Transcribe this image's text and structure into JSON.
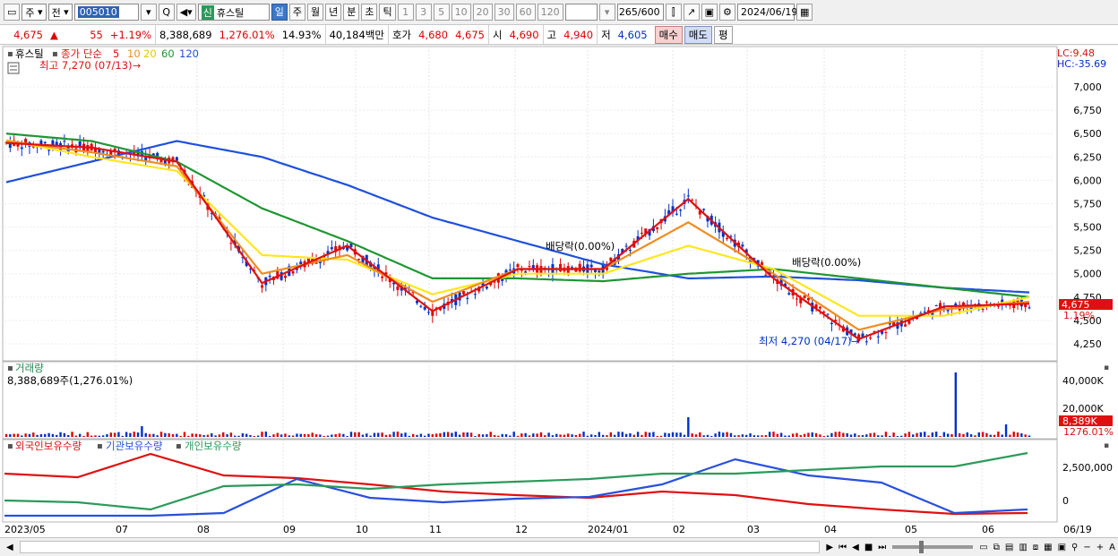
{
  "toolbar": {
    "period_type": "주",
    "prev": "전",
    "code": "005010",
    "stock_badge": "신",
    "stock_name": "휴스틸",
    "periods": [
      "일",
      "주",
      "월",
      "년",
      "분",
      "초",
      "틱"
    ],
    "active_period": "일",
    "intervals": [
      "1",
      "3",
      "5",
      "10",
      "20",
      "30",
      "60",
      "120"
    ],
    "count": "265",
    "count_max": "/600",
    "date": "2024/06/19"
  },
  "quote": {
    "price": "4,675",
    "change_arrow": "▲",
    "change": "55",
    "change_pct": "+1.19%",
    "volume": "8,388,689",
    "volume_pct": "1,276.01%",
    "turnover": "14.93%",
    "amount": "40,184백만",
    "ask_label": "호가",
    "ask1": "4,680",
    "ask2": "4,675",
    "open_label": "시",
    "open": "4,690",
    "high_label": "고",
    "high": "4,940",
    "low_label": "저",
    "low": "4,605",
    "buy_label": "매수",
    "sell_label": "매도",
    "eval_label": "평"
  },
  "price_panel": {
    "stock_name": "휴스틸",
    "ma_title": "종가 단순",
    "ma_periods": [
      "5",
      "10",
      "20",
      "60",
      "120"
    ],
    "max_label": "최고 7,270 (07/13)",
    "min_label": "최저 4,270 (04/17)",
    "dividend_label_1": "배당락(0.00%)",
    "dividend_label_2": "배당락(0.00%)",
    "lc": "LC:9.48",
    "hc": "HC:-35.69",
    "current_tag": "4,675",
    "current_pct_tag": "1.19%",
    "y_ticks": [
      "7,000",
      "6,750",
      "6,500",
      "6,250",
      "6,000",
      "5,750",
      "5,500",
      "5,250",
      "5,000",
      "4,750",
      "4,500",
      "4,250"
    ]
  },
  "volume_panel": {
    "title": "거래량",
    "value_label": "8,388,689주(1,276.01%)",
    "y_ticks": [
      "40,000K",
      "20,000K"
    ],
    "current_tag": "8,389K",
    "current_pct_tag": "1276.01%"
  },
  "holding_panel": {
    "series": [
      "외국인보유수량",
      "기관보유수량",
      "개인보유수량"
    ],
    "y_ticks": [
      "2,500,000",
      "0"
    ]
  },
  "x_axis": [
    "2023/05",
    "07",
    "08",
    "09",
    "10",
    "11",
    "12",
    "2024/01",
    "02",
    "03",
    "04",
    "05",
    "06",
    "06/19"
  ],
  "colors": {
    "ma5": "#e01010",
    "ma10": "#f08c1e",
    "ma20": "#ffe61e",
    "ma60": "#1e9632",
    "ma120": "#1e50dc",
    "up": "#e00000",
    "down": "#0030c8",
    "foreign": "#e01010",
    "institution": "#2850dc",
    "individual": "#2a9a5a"
  },
  "chart_data": {
    "type": "line",
    "x": [
      "2023/05",
      "07",
      "08",
      "09",
      "10",
      "11",
      "12",
      "2024/01",
      "02",
      "03",
      "04",
      "05",
      "06"
    ],
    "series": [
      {
        "name": "5",
        "values": [
          6400,
          6350,
          6200,
          4900,
          5300,
          4600,
          5050,
          5050,
          5800,
          4950,
          4300,
          4650,
          4680
        ]
      },
      {
        "name": "10",
        "values": [
          6420,
          6300,
          6150,
          5000,
          5200,
          4700,
          5050,
          5050,
          5550,
          5000,
          4400,
          4620,
          4700
        ]
      },
      {
        "name": "20",
        "values": [
          6430,
          6250,
          6100,
          5200,
          5150,
          4780,
          5000,
          5000,
          5300,
          5050,
          4550,
          4550,
          4750
        ]
      },
      {
        "name": "60",
        "values": [
          6500,
          6420,
          6200,
          5700,
          5350,
          4950,
          4950,
          4920,
          5000,
          5050,
          4950,
          4850,
          4750
        ]
      },
      {
        "name": "120",
        "values": [
          5980,
          6200,
          6420,
          6250,
          5950,
          5600,
          5350,
          5100,
          4950,
          4970,
          4930,
          4850,
          4800
        ]
      }
    ],
    "ylim": [
      4250,
      7000
    ],
    "y_ticks": [
      7000,
      6750,
      6500,
      6250,
      6000,
      5750,
      5500,
      5250,
      5000,
      4750,
      4500,
      4250
    ]
  }
}
